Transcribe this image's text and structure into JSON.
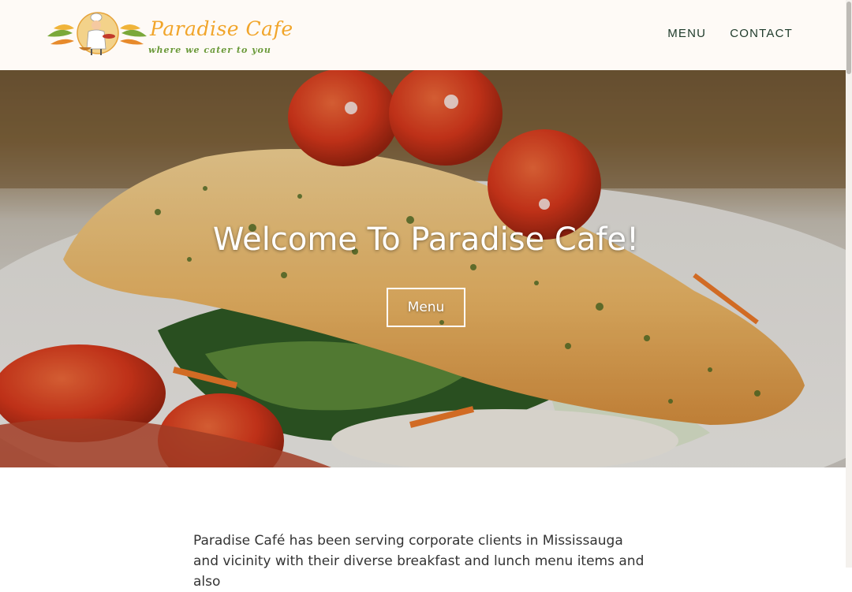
{
  "header": {
    "logo": {
      "title": "Paradise Cafe",
      "tagline": "where we cater to you"
    },
    "nav": [
      {
        "label": "MENU"
      },
      {
        "label": "CONTACT"
      }
    ]
  },
  "hero": {
    "title": "Welcome To Paradise Cafe!",
    "button_label": "Menu"
  },
  "intro": {
    "text": "Paradise Café has been serving corporate clients in Mississauga and vicinity with their diverse breakfast and lunch menu items and also"
  },
  "colors": {
    "header_bg": "#fefaf6",
    "logo_orange": "#f1a52a",
    "logo_green": "#6b9a3a",
    "nav_text": "#1e3a2a",
    "hero_text": "#ffffff"
  }
}
